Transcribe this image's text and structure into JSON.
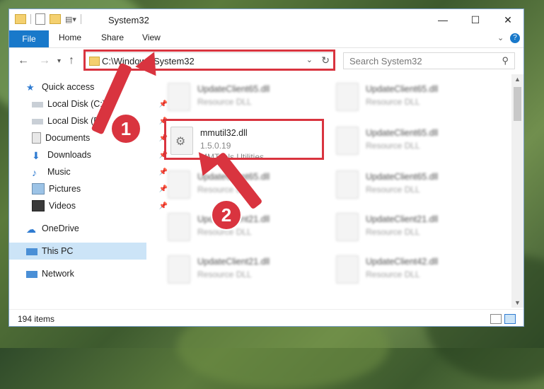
{
  "window": {
    "title": "System32",
    "controls": {
      "minimize": "—",
      "maximize": "☐",
      "close": "✕"
    }
  },
  "ribbon": {
    "tabs": [
      "File",
      "Home",
      "Share",
      "View"
    ]
  },
  "address": {
    "path": "C:\\Windows\\System32",
    "search_placeholder": "Search System32"
  },
  "sidebar": {
    "items": [
      {
        "label": "Quick access",
        "icon": "star-icon"
      },
      {
        "label": "Local Disk (C:)",
        "icon": "drive-icon"
      },
      {
        "label": "Local Disk (D:)",
        "icon": "drive-icon"
      },
      {
        "label": "Documents",
        "icon": "documents-icon"
      },
      {
        "label": "Downloads",
        "icon": "download-icon"
      },
      {
        "label": "Music",
        "icon": "music-icon"
      },
      {
        "label": "Pictures",
        "icon": "pictures-icon"
      },
      {
        "label": "Videos",
        "icon": "videos-icon"
      },
      {
        "label": "OneDrive",
        "icon": "cloud-icon"
      },
      {
        "label": "This PC",
        "icon": "computer-icon"
      },
      {
        "label": "Network",
        "icon": "network-icon"
      }
    ]
  },
  "files": {
    "highlighted": {
      "name": "mmutil32.dll",
      "version": "1.5.0.19",
      "company": "MMTools Utilities"
    },
    "blurred": [
      {
        "name": "UpdateClient65.dll",
        "desc": "Resource DLL"
      },
      {
        "name": "UpdateClient65.dll",
        "desc": "Resource DLL"
      },
      {
        "name": "UpdateClient65.dll",
        "desc": "Resource DLL"
      },
      {
        "name": "UpdateClient65.dll",
        "desc": "Resource DLL"
      },
      {
        "name": "UpdateClient65.dll",
        "desc": "Resource DLL"
      },
      {
        "name": "UpdateClient21.dll",
        "desc": "Resource DLL"
      },
      {
        "name": "UpdateClient21.dll",
        "desc": "Resource DLL"
      },
      {
        "name": "UpdateClient21.dll",
        "desc": "Resource DLL"
      },
      {
        "name": "UpdateClient42.dll",
        "desc": "Resource DLL"
      }
    ]
  },
  "status": {
    "item_count": "194 items"
  },
  "annotations": {
    "step1": "1",
    "step2": "2",
    "color": "#d9343f"
  }
}
